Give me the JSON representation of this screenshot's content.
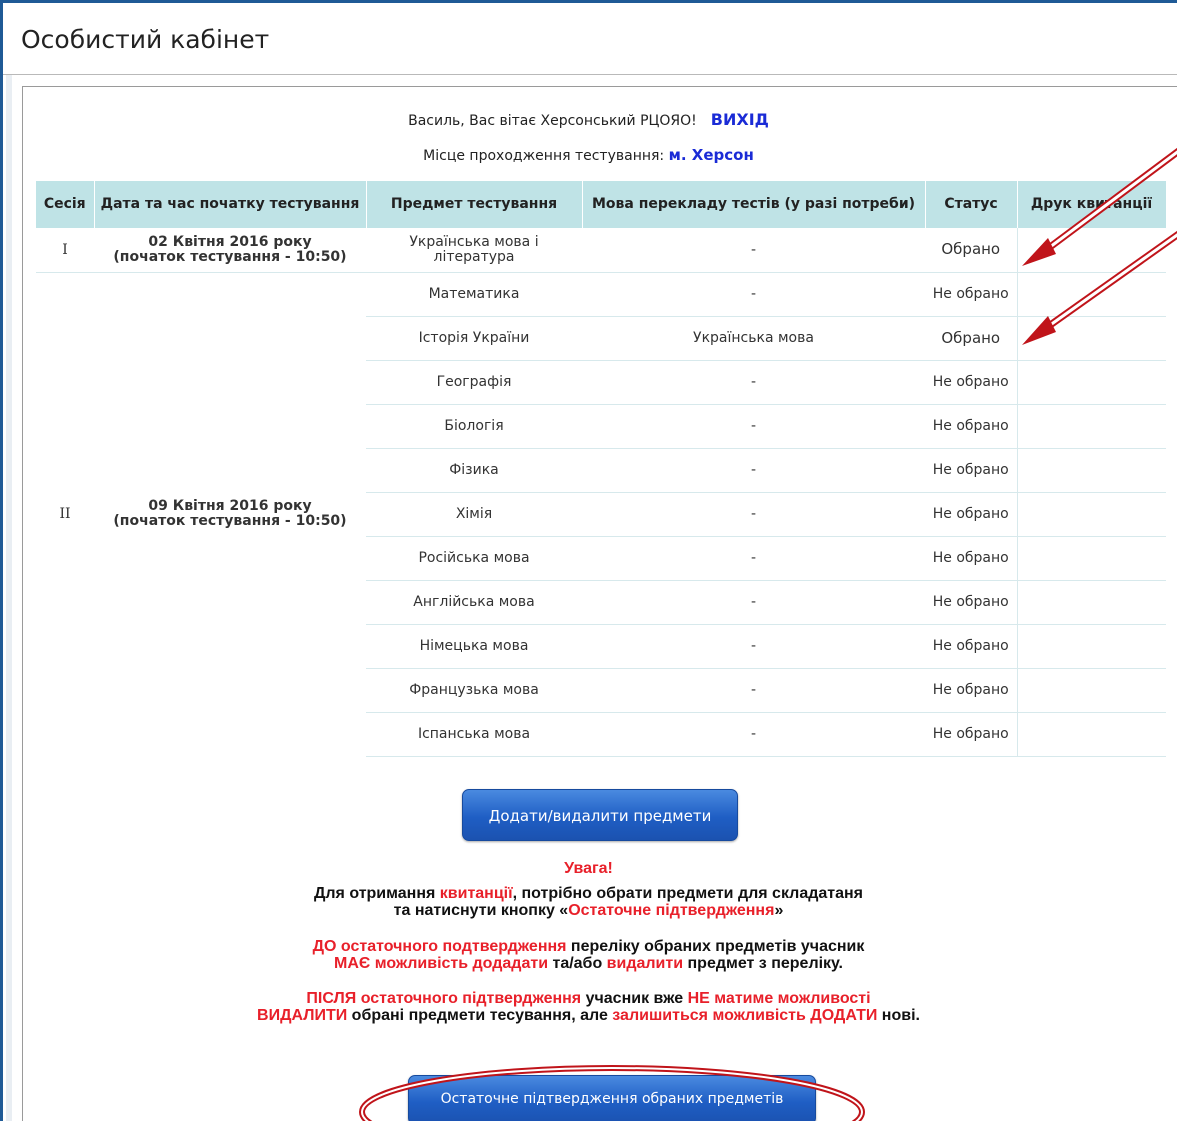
{
  "window": {
    "title": "Особистий кабінет"
  },
  "greeting": {
    "text": "Василь, Вас вітає Херсонський РЦОЯО!",
    "exit_label": "ВИХІД"
  },
  "location": {
    "label": "Місце проходження тестування:",
    "city": "м. Херсон"
  },
  "table": {
    "headers": [
      "Сесія",
      "Дата та час початку тестування",
      "Предмет тестування",
      "Мова перекладу тестів (у разі потреби)",
      "Статус",
      "Друк квитанції"
    ],
    "sessions": [
      {
        "session": "I",
        "date": "02 Квітня 2016 року",
        "time": "(початок тестування - 10:50)"
      },
      {
        "session": "II",
        "date": "09 Квітня 2016 року",
        "time": "(початок тестування - 10:50)"
      }
    ],
    "rows": [
      {
        "subject": "Українська мова і література",
        "lang": "-",
        "status": "Обрано"
      },
      {
        "subject": "Математика",
        "lang": "-",
        "status": "Не обрано"
      },
      {
        "subject": "Історія України",
        "lang": "Українська мова",
        "status": "Обрано"
      },
      {
        "subject": "Географія",
        "lang": "-",
        "status": "Не обрано"
      },
      {
        "subject": "Біологія",
        "lang": "-",
        "status": "Не обрано"
      },
      {
        "subject": "Фізика",
        "lang": "-",
        "status": "Не обрано"
      },
      {
        "subject": "Хімія",
        "lang": "-",
        "status": "Не обрано"
      },
      {
        "subject": "Російська мова",
        "lang": "-",
        "status": "Не обрано"
      },
      {
        "subject": "Англійська мова",
        "lang": "-",
        "status": "Не обрано"
      },
      {
        "subject": "Німецька мова",
        "lang": "-",
        "status": "Не обрано"
      },
      {
        "subject": "Французька мова",
        "lang": "-",
        "status": "Не обрано"
      },
      {
        "subject": "Іспанська мова",
        "lang": "-",
        "status": "Не обрано"
      }
    ]
  },
  "buttons": {
    "add_remove": "Додати/видалити предмети",
    "final_confirm": "Остаточне підтвердження обраних предметів"
  },
  "notice": {
    "title": "Увага!",
    "p1_a": "Для отримання ",
    "p1_b": "квитанції",
    "p1_c": ", потрібно обрати предмети для складатаня",
    "p1_d": "та натиснути кнопку «",
    "p1_e": "Остаточне підтвердження",
    "p1_f": "»",
    "p2_a": "ДО остаточного подтвердження",
    "p2_b": " переліку обраних предметів учасник",
    "p2_c": "МАЄ можливість додадати",
    "p2_d": " та/або ",
    "p2_e": "видалити",
    "p2_f": " предмет з переліку.",
    "p3_a": "ПІСЛЯ остаточного підтвердження",
    "p3_b": " учасник вже ",
    "p3_c": "НЕ матиме можливості",
    "p3_d": "ВИДАЛИТИ",
    "p3_e": " обрані предмети тесування, але ",
    "p3_f": "залишиться можливість ДОДАТИ",
    "p3_g": " нові."
  },
  "colors": {
    "annotation": "#c0141a",
    "header_bg": "#bfe3e6",
    "link": "#1a2bd6",
    "button": "#1f5ec4"
  }
}
